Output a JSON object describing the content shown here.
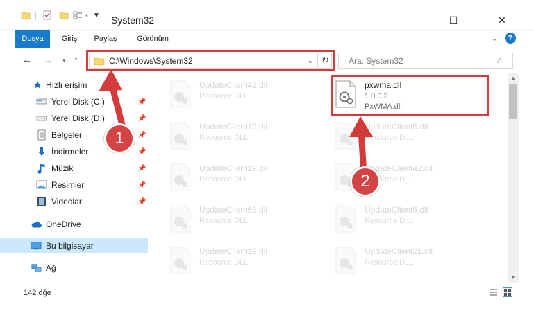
{
  "window": {
    "title": "System32",
    "minimize": "—",
    "maximize": "☐",
    "close": "✕"
  },
  "ribbon": {
    "tabs": [
      {
        "label": "Dosya",
        "active": true
      },
      {
        "label": "Giriş",
        "active": false
      },
      {
        "label": "Paylaş",
        "active": false
      },
      {
        "label": "Görünüm",
        "active": false
      }
    ],
    "help": "?"
  },
  "address": {
    "path": "C:\\Windows\\System32",
    "dropdown": "⌄",
    "refresh": "↻"
  },
  "search": {
    "placeholder": "Ara: System32",
    "icon": "⌕"
  },
  "sidebar": {
    "items": [
      {
        "label": "Hızlı erişim",
        "icon": "star-icon",
        "pinned": false
      },
      {
        "label": "Yerel Disk (C:)",
        "icon": "drive-icon",
        "pinned": true
      },
      {
        "label": "Yerel Disk (D:)",
        "icon": "drive-icon",
        "pinned": true
      },
      {
        "label": "Belgeler",
        "icon": "documents-icon",
        "pinned": true
      },
      {
        "label": "İndirmeler",
        "icon": "download-icon",
        "pinned": true
      },
      {
        "label": "Müzik",
        "icon": "music-icon",
        "pinned": true
      },
      {
        "label": "Resimler",
        "icon": "pictures-icon",
        "pinned": true
      },
      {
        "label": "Videolar",
        "icon": "videos-icon",
        "pinned": true
      },
      {
        "label": "OneDrive",
        "icon": "cloud-icon",
        "pinned": false
      },
      {
        "label": "Bu bilgisayar",
        "icon": "computer-icon",
        "pinned": false
      },
      {
        "label": "Ağ",
        "icon": "network-icon",
        "pinned": false
      }
    ]
  },
  "files": [
    {
      "name": "UpdateClient42.dll",
      "desc": "Resource DLL"
    },
    {
      "name": "pxwma.dll",
      "desc": "1.0.0.2",
      "desc2": "PxWMA.dll",
      "focus": true
    },
    {
      "name": "UpdateClient19.dll",
      "desc": "Resource DLL"
    },
    {
      "name": "UpdateClient5.dll",
      "desc": "Resource DLL"
    },
    {
      "name": "UpdateClient19.dll",
      "desc": "Resource DLL"
    },
    {
      "name": "UpdateClient42.dll",
      "desc": "Resource DLL"
    },
    {
      "name": "UpdateClient65.dll",
      "desc": "Resource DLL"
    },
    {
      "name": "UpdateClient5.dll",
      "desc": "Resource DLL"
    },
    {
      "name": "UpdateClient19.dll",
      "desc": "Resource DLL"
    },
    {
      "name": "UpdateClient21.dll",
      "desc": "Resource DLL"
    }
  ],
  "status": {
    "count": "142 öğe"
  },
  "annotations": {
    "badge1": "1",
    "badge2": "2",
    "color": "#d33b3b"
  }
}
